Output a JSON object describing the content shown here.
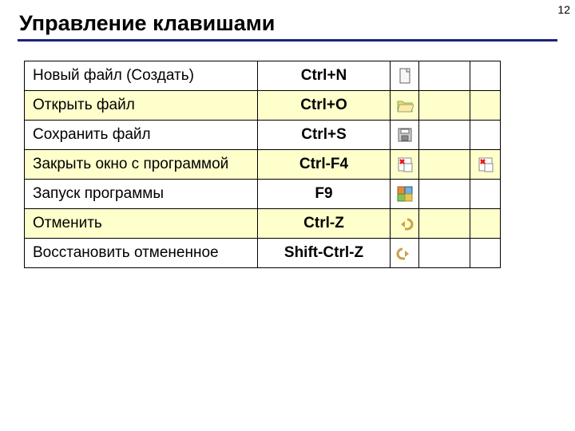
{
  "page_number": "12",
  "title": "Управление клавишами",
  "rows": [
    {
      "action": "Новый файл (Создать)",
      "key": "Ctrl+N",
      "hl": false,
      "icon1": "new-file-icon",
      "icon2": ""
    },
    {
      "action": "Открыть файл",
      "key": "Ctrl+O",
      "hl": true,
      "icon1": "open-file-icon",
      "icon2": ""
    },
    {
      "action": "Сохранить файл",
      "key": "Ctrl+S",
      "hl": false,
      "icon1": "save-icon",
      "icon2": ""
    },
    {
      "action": "Закрыть окно с программой",
      "key": "Ctrl-F4",
      "hl": true,
      "icon1": "close-window-icon",
      "icon2": "close-window-icon"
    },
    {
      "action": "Запуск программы",
      "key": "F9",
      "hl": false,
      "icon1": "run-icon",
      "icon2": ""
    },
    {
      "action": "Отменить",
      "key": "Ctrl-Z",
      "hl": true,
      "icon1": "undo-icon",
      "icon2": ""
    },
    {
      "action": "Восстановить отмененное",
      "key": "Shift-Ctrl-Z",
      "hl": false,
      "icon1": "redo-icon",
      "icon2": ""
    }
  ]
}
